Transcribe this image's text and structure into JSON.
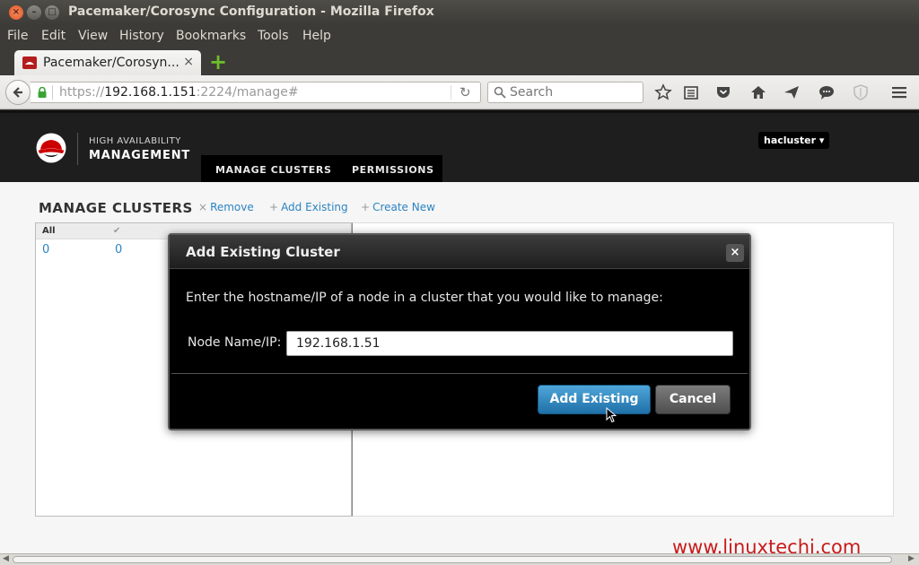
{
  "window": {
    "title": "Pacemaker/Corosync Configuration - Mozilla Firefox",
    "close_glyph": "×",
    "min_glyph": "–",
    "max_glyph": "□"
  },
  "menu": [
    "File",
    "Edit",
    "View",
    "History",
    "Bookmarks",
    "Tools",
    "Help"
  ],
  "tab": {
    "title": "Pacemaker/Corosyn...",
    "close_glyph": "×",
    "new_tab_glyph": "+"
  },
  "urlbar": {
    "scheme": "https://",
    "host": "192.168.1.151",
    "rest": ":2224/manage#",
    "reload_glyph": "↻"
  },
  "searchbar": {
    "placeholder": "Search"
  },
  "app": {
    "brand_line1": "HIGH AVAILABILITY",
    "brand_line2": "MANAGEMENT",
    "user": "hacluster ▾",
    "nav": [
      "MANAGE CLUSTERS",
      "PERMISSIONS"
    ],
    "accent_color": "#cc0000"
  },
  "clusters": {
    "title": "MANAGE CLUSTERS",
    "actions": [
      {
        "symbol": "×",
        "label": "Remove"
      },
      {
        "symbol": "+",
        "label": "Add Existing"
      },
      {
        "symbol": "+",
        "label": "Create New"
      }
    ],
    "columns": [
      {
        "header": "All",
        "value": "0"
      },
      {
        "header": "✔",
        "value": "0"
      }
    ],
    "watermark": "www.linuxtechi.com"
  },
  "modal": {
    "title": "Add Existing Cluster",
    "close_glyph": "×",
    "description": "Enter the hostname/IP of a node in a cluster that you would like to manage:",
    "field_label": "Node Name/IP:",
    "field_value": "192.168.1.51",
    "primary_button": "Add Existing",
    "cancel_button": "Cancel",
    "primary_color": "#2b84c3"
  },
  "scrollbar": {
    "left_glyph": "◀",
    "right_glyph": "▶"
  }
}
